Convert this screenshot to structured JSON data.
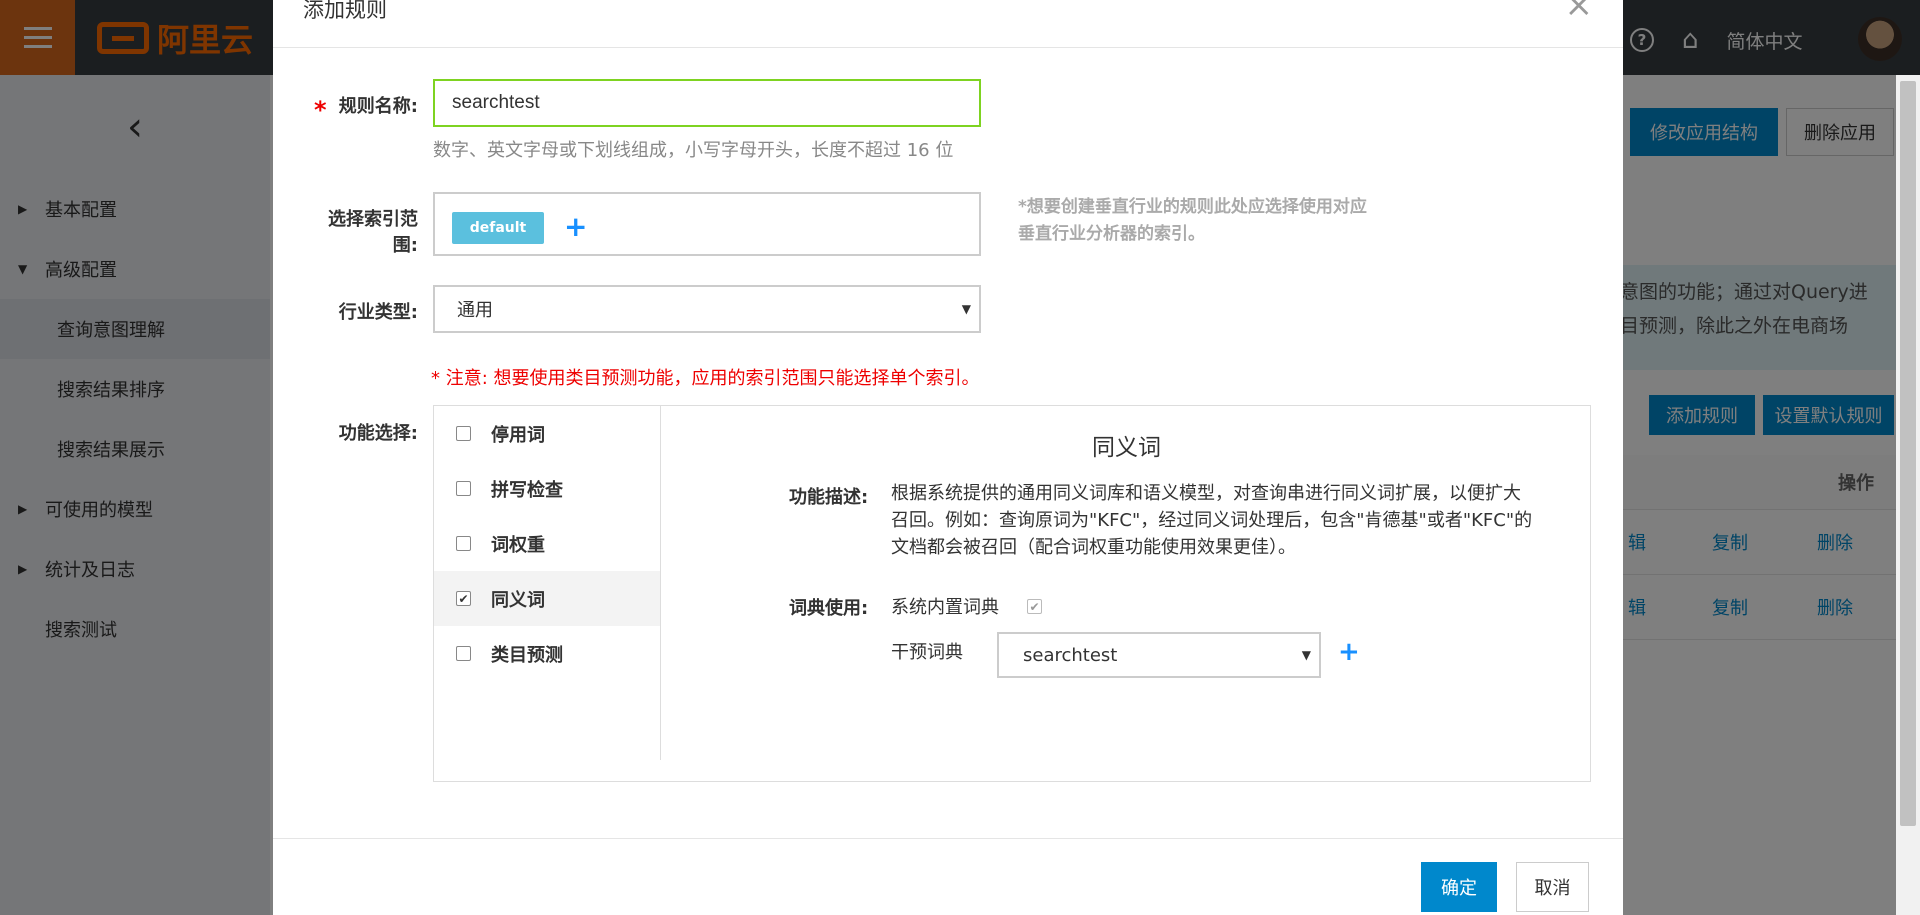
{
  "brand": {
    "name": "阿里云"
  },
  "topbar": {
    "help_icon": "question-circle-icon",
    "home_icon": "home-icon",
    "language": "简体中文"
  },
  "sidebar": {
    "items": [
      {
        "label": "基本配置",
        "caret": "▶"
      },
      {
        "label": "高级配置",
        "caret": "▼"
      },
      {
        "label": "查询意图理解"
      },
      {
        "label": "搜索结果排序"
      },
      {
        "label": "搜索结果展示"
      },
      {
        "label": "可使用的模型",
        "caret": "▶"
      },
      {
        "label": "统计及日志",
        "caret": "▶"
      },
      {
        "label": "搜索测试"
      }
    ]
  },
  "background": {
    "modify_structure": "修改应用结构",
    "delete_app": "删除应用",
    "info_line1": "意图的功能；通过对Query进",
    "info_line2": "目预测，除此之外在电商场",
    "add_rule": "添加规则",
    "set_default_rule": "设置默认规则",
    "table_header_ops": "操作",
    "row1": {
      "edit": "辑",
      "copy": "复制",
      "delete": "删除"
    },
    "row2": {
      "edit": "辑",
      "copy": "复制",
      "delete": "删除"
    }
  },
  "modal": {
    "title": "添加规则",
    "close": "×",
    "rule_name_label": "规则名称:",
    "rule_name_value": "searchtest",
    "rule_name_hint": "数字、英文字母或下划线组成，小写字母开头，长度不超过 16 位",
    "index_label": "选择索引范围:",
    "index_tag": "default",
    "index_note_line1": "*想要创建垂直行业的规则此处应选择使用对应",
    "index_note_line2": "垂直行业分析器的索引。",
    "industry_label": "行业类型:",
    "industry_value": "通用",
    "warning": "* 注意: 想要使用类目预测功能，应用的索引范围只能选择单个索引。",
    "function_label": "功能选择:",
    "functions": [
      {
        "label": "停用词",
        "checked": false
      },
      {
        "label": "拼写检查",
        "checked": false
      },
      {
        "label": "词权重",
        "checked": false
      },
      {
        "label": "同义词",
        "checked": true
      },
      {
        "label": "类目预测",
        "checked": false
      }
    ],
    "detail": {
      "title": "同义词",
      "desc_label": "功能描述:",
      "desc_line1": "根据系统提供的通用同义词库和语义模型，对查询串进行同义词扩展，以便扩大",
      "desc_line2": "召回。例如：查询原词为\"KFC\"，经过同义词处理后，包含\"肯德基\"或者\"KFC\"的",
      "desc_line3": "文档都会被召回（配合词权重功能使用效果更佳）。",
      "dict_label": "词典使用:",
      "builtin_dict": "系统内置词典",
      "intervene_dict": "干预词典",
      "intervene_value": "searchtest"
    },
    "ok": "确定",
    "cancel": "取消"
  }
}
